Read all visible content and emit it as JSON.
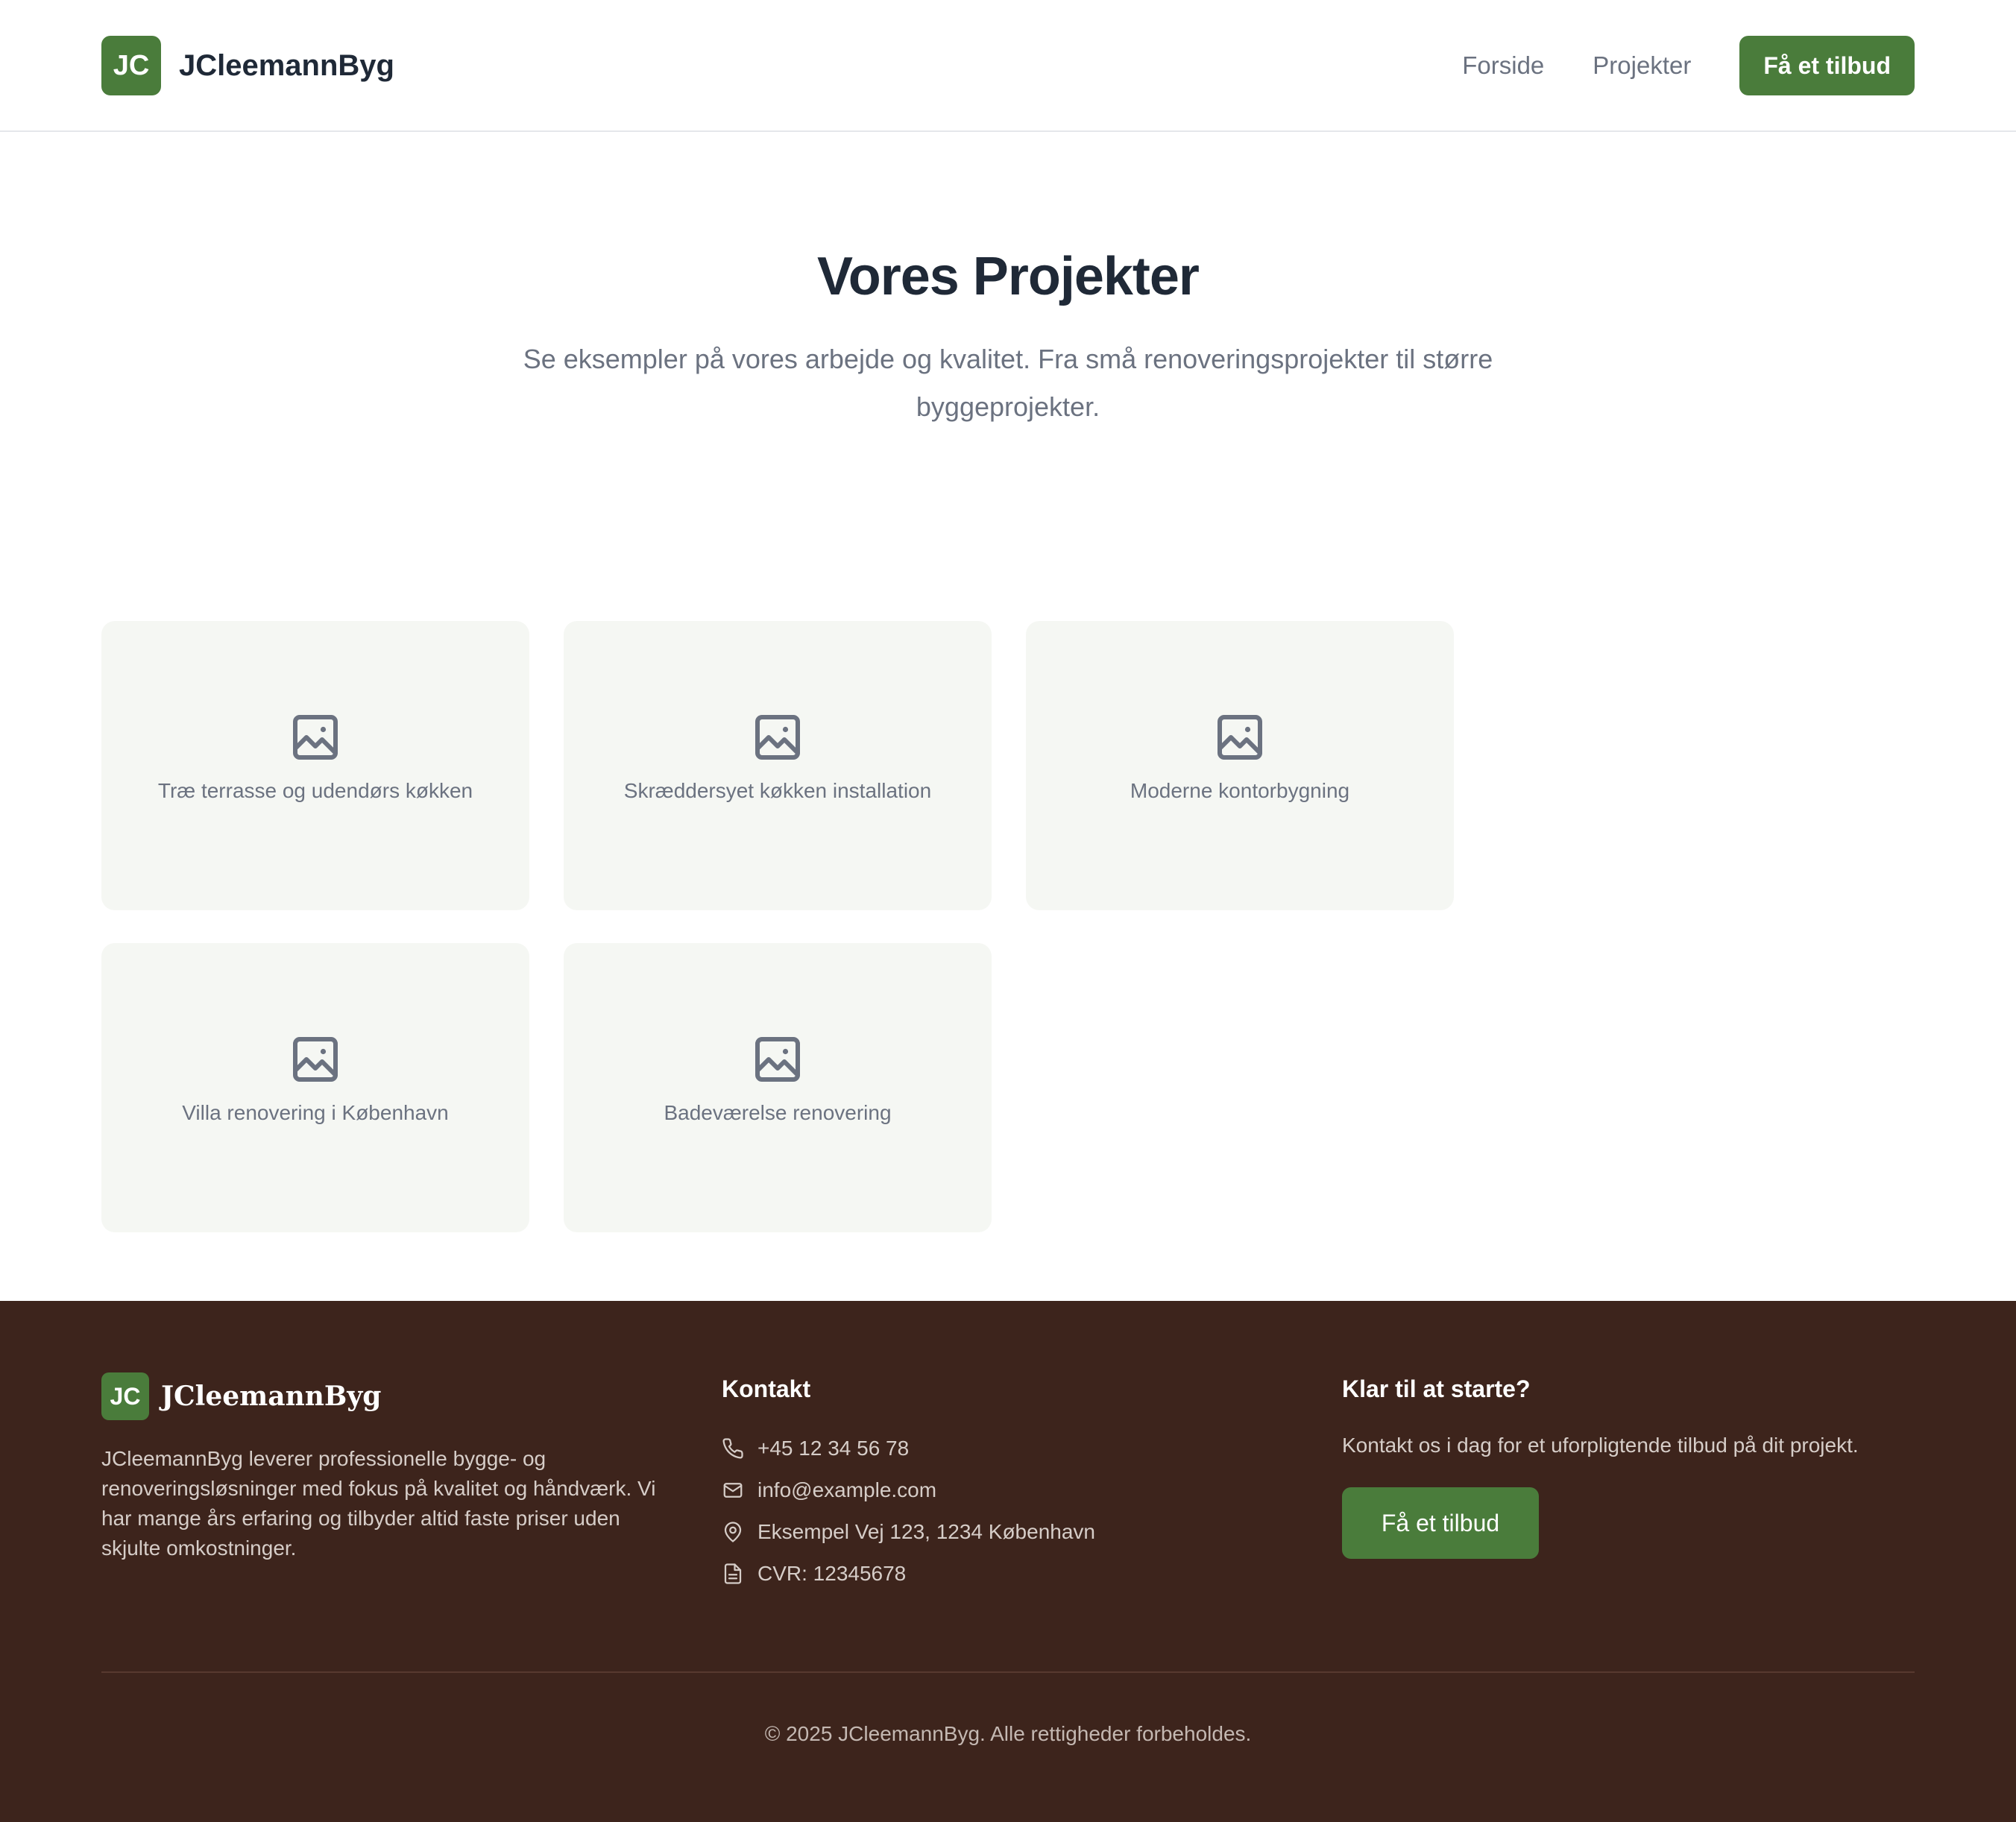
{
  "header": {
    "logo_initials": "JC",
    "brand": "JCleemannByg",
    "nav": [
      "Forside",
      "Projekter"
    ],
    "cta": "Få et tilbud"
  },
  "hero": {
    "title": "Vores Projekter",
    "subtitle": "Se eksempler på vores arbejde og kvalitet. Fra små renoveringsprojekter til større byggeprojekter."
  },
  "projects": [
    {
      "label": "Træ terrasse og udendørs køkken",
      "icon": "image-icon"
    },
    {
      "label": "Skræddersyet køkken installation",
      "icon": "image-icon"
    },
    {
      "label": "Moderne kontorbygning",
      "icon": "image-icon"
    },
    {
      "label": "Villa renovering i København",
      "icon": "image-icon"
    },
    {
      "label": "Badeværelse renovering",
      "icon": "image-icon"
    }
  ],
  "footer": {
    "logo_initials": "JC",
    "brand": "JCleemannByg",
    "description": "JCleemannByg leverer professionelle bygge- og renoveringsløsninger med fokus på kvalitet og håndværk. Vi har mange års erfaring og tilbyder altid faste priser uden skjulte omkostninger.",
    "contact_heading": "Kontakt",
    "contact": [
      {
        "icon": "phone-icon",
        "text": "+45 12 34 56 78"
      },
      {
        "icon": "mail-icon",
        "text": "info@example.com"
      },
      {
        "icon": "map-pin-icon",
        "text": "Eksempel Vej 123, 1234 København"
      },
      {
        "icon": "document-icon",
        "text": "CVR: 12345678"
      }
    ],
    "cta_heading": "Klar til at starte?",
    "cta_text": "Kontakt os i dag for et uforpligtende tilbud på dit projekt.",
    "cta_button": "Få et tilbud",
    "copyright": "© 2025 JCleemannByg. Alle rettigheder forbeholdes."
  },
  "colors": {
    "brand_green": "#4a7c3b",
    "footer_brown": "#3d241c",
    "card_bg": "#f5f7f3"
  }
}
